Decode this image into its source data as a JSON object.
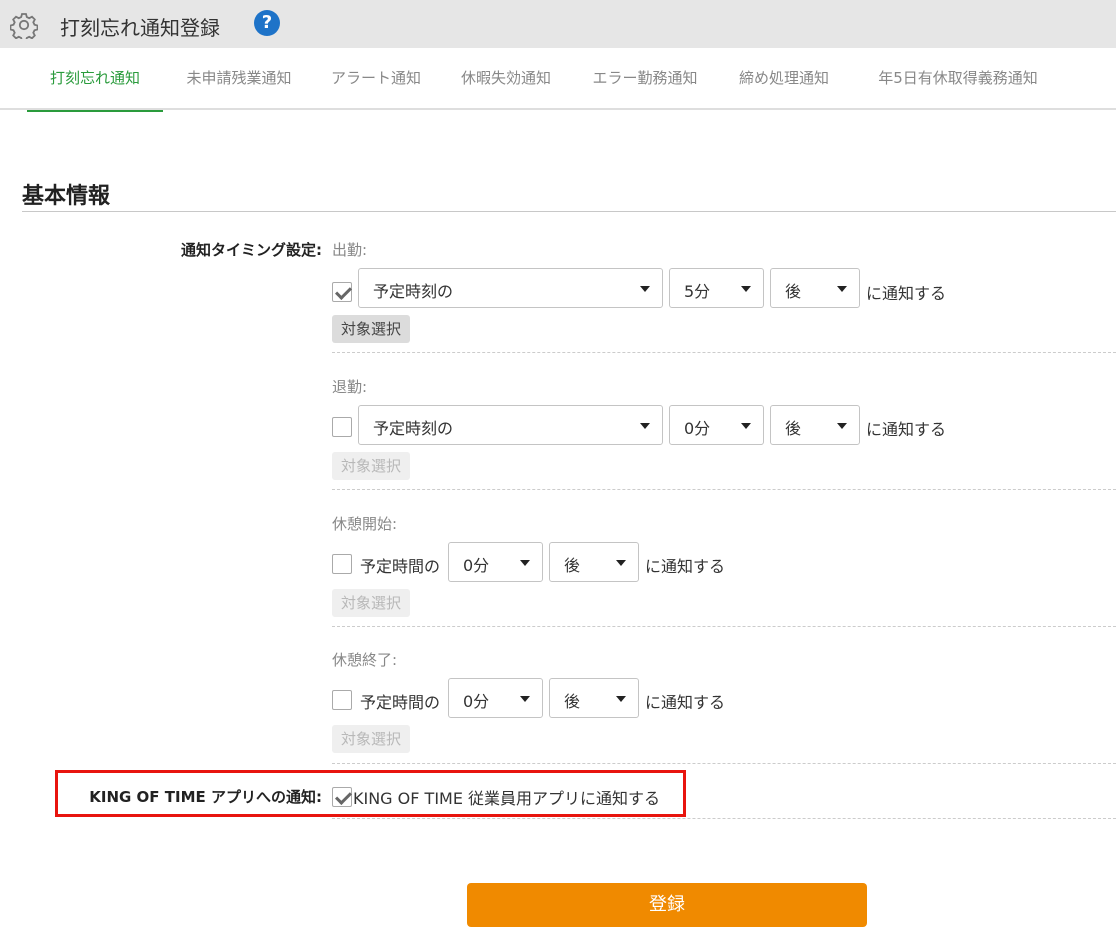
{
  "header": {
    "title": "打刻忘れ通知登録",
    "help_symbol": "?"
  },
  "tabs": [
    {
      "label": "打刻忘れ通知",
      "active": true
    },
    {
      "label": "未申請残業通知",
      "active": false
    },
    {
      "label": "アラート通知",
      "active": false
    },
    {
      "label": "休暇失効通知",
      "active": false
    },
    {
      "label": "エラー勤務通知",
      "active": false
    },
    {
      "label": "締め処理通知",
      "active": false
    },
    {
      "label": "年5日有休取得義務通知",
      "active": false
    }
  ],
  "section": {
    "title": "基本情報"
  },
  "timing": {
    "label": "通知タイミング設定:",
    "suffix": "に通知する",
    "target_button": "対象選択",
    "groups": [
      {
        "label": "出勤:",
        "checked": true,
        "basis": "予定時刻の",
        "minutes": "5分",
        "when": "後"
      },
      {
        "label": "退勤:",
        "checked": false,
        "basis": "予定時刻の",
        "minutes": "0分",
        "when": "後"
      },
      {
        "label": "休憩開始:",
        "checked": false,
        "basis": "予定時間の",
        "minutes": "0分",
        "when": "後"
      },
      {
        "label": "休憩終了:",
        "checked": false,
        "basis": "予定時間の",
        "minutes": "0分",
        "when": "後"
      }
    ]
  },
  "app_notify": {
    "label": "KING OF TIME アプリへの通知:",
    "checked": true,
    "option": "KING OF TIME 従業員用アプリに通知する"
  },
  "submit": {
    "label": "登録"
  },
  "colors": {
    "active_tab": "#2a9b3c",
    "submit": "#f08a00",
    "highlight": "#e8140e",
    "help_icon": "#1e73c8"
  }
}
